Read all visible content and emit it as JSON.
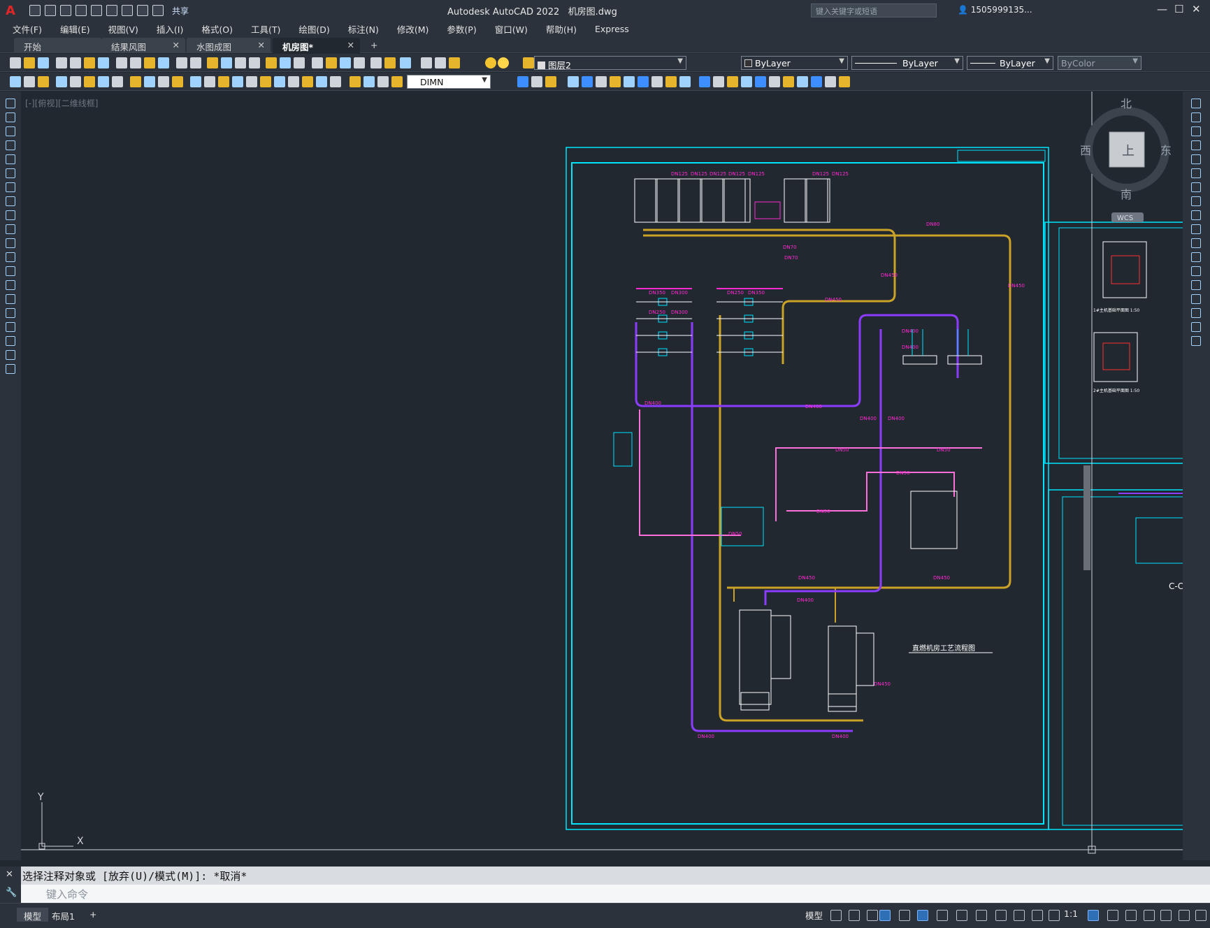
{
  "app": {
    "title": "Autodesk AutoCAD 2022",
    "filename": "机房图.dwg",
    "share_label": "共享",
    "search_placeholder": "键入关键字或短语",
    "user": "1505999135...",
    "logo": "A"
  },
  "menu": [
    "文件(F)",
    "编辑(E)",
    "视图(V)",
    "插入(I)",
    "格式(O)",
    "工具(T)",
    "绘图(D)",
    "标注(N)",
    "修改(M)",
    "参数(P)",
    "窗口(W)",
    "帮助(H)",
    "Express"
  ],
  "tabs": [
    {
      "label": "开始",
      "active": false
    },
    {
      "label": "结果风图",
      "active": false
    },
    {
      "label": "水图成图",
      "active": false
    },
    {
      "label": "机房图*",
      "active": true
    }
  ],
  "toolbar": {
    "layer": "图层2",
    "color": "ByLayer",
    "linetype": "ByLayer",
    "lineweight": "ByLayer",
    "plotstyle": "ByColor",
    "dimstyle": "DIMN"
  },
  "viewport": {
    "label": "[-][俯视][二维线框]",
    "viewcube": {
      "north": "北",
      "south": "南",
      "east": "东",
      "west": "西",
      "face": "上",
      "wcs": "WCS"
    },
    "ucs": {
      "x": "X",
      "y": "Y"
    }
  },
  "drawing": {
    "pipe_labels": [
      "DN125",
      "DN125",
      "DN125",
      "DN125",
      "DN125",
      "DN125",
      "DN125",
      "DN70",
      "DN80",
      "DN70",
      "DN450",
      "DN450",
      "DN450",
      "DN350",
      "DN300",
      "DN250",
      "DN300",
      "DN250",
      "DN350",
      "DN400",
      "DN400",
      "DN400",
      "DN400",
      "DN400",
      "DN400",
      "DN50",
      "DN50",
      "DN50",
      "DN50",
      "DN50",
      "DN450",
      "DN450",
      "DN400",
      "DN450",
      "DN400",
      "DN400"
    ],
    "drawing_title": "直燃机房工艺流程图",
    "sheet_labels": [
      "1#主机基础平面图 1:50",
      "2#主机基础平面图 1:50",
      "C-C"
    ]
  },
  "command": {
    "history": "选择注释对象或 [放弃(U)/模式(M)]: *取消*",
    "placeholder": "键入命令"
  },
  "status": {
    "layouts": [
      {
        "label": "模型",
        "active": true
      },
      {
        "label": "布局1",
        "active": false
      }
    ],
    "mode": "模型",
    "scale": "1:1"
  },
  "colors": {
    "bg": "#212830",
    "chrome": "#2b323b",
    "frame": "#00e5ff",
    "pipe_yellow": "#c9a227",
    "pipe_purple": "#8b3dff",
    "pipe_pink": "#ff6fd8",
    "label": "#ff2bd1",
    "equipment": "#ffffff"
  }
}
